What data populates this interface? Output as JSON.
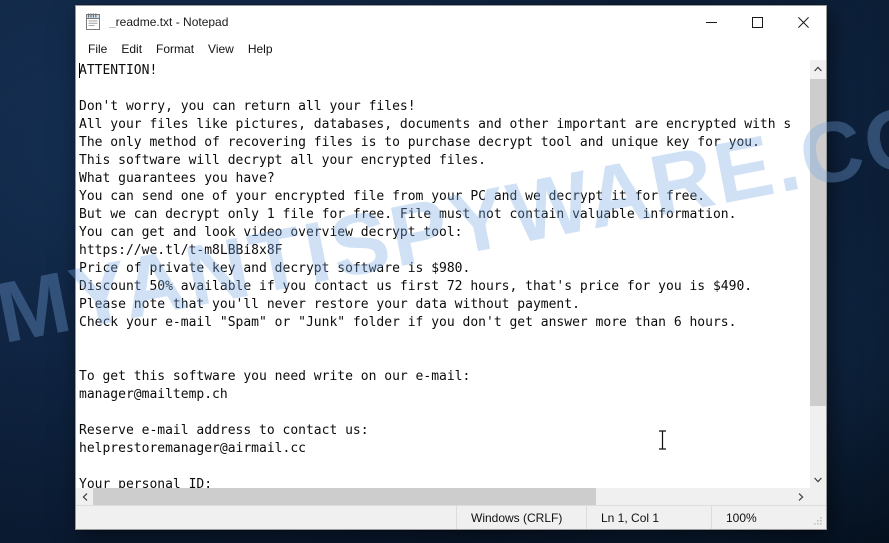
{
  "desktop": {
    "background_color": "#0d2343",
    "watermark_text": "MYANTISPYWARE.COM",
    "watermark_color": "#78a8e2"
  },
  "window": {
    "icon": "notepad-icon",
    "title": "_readme.txt - Notepad",
    "controls": {
      "minimize": "minimize-icon",
      "maximize": "maximize-icon",
      "close": "close-icon"
    }
  },
  "menubar": {
    "items": [
      {
        "label": "File"
      },
      {
        "label": "Edit"
      },
      {
        "label": "Format"
      },
      {
        "label": "View"
      },
      {
        "label": "Help"
      }
    ]
  },
  "editor": {
    "content": "ATTENTION!\n\nDon't worry, you can return all your files!\nAll your files like pictures, databases, documents and other important are encrypted with s\nThe only method of recovering files is to purchase decrypt tool and unique key for you.\nThis software will decrypt all your encrypted files.\nWhat guarantees you have?\nYou can send one of your encrypted file from your PC and we decrypt it for free.\nBut we can decrypt only 1 file for free. File must not contain valuable information.\nYou can get and look video overview decrypt tool:\nhttps://we.tl/t-m8LBBi8x8F\nPrice of private key and decrypt software is $980.\nDiscount 50% available if you contact us first 72 hours, that's price for you is $490.\nPlease note that you'll never restore your data without payment.\nCheck your e-mail \"Spam\" or \"Junk\" folder if you don't get answer more than 6 hours.\n\n\nTo get this software you need write on our e-mail:\nmanager@mailtemp.ch\n\nReserve e-mail address to contact us:\nhelprestoremanager@airmail.cc\n\nYour personal ID:",
    "details": {
      "heading": "ATTENTION!",
      "video_url": "https://we.tl/t-m8LBBi8x8F",
      "price_full": "$980",
      "price_discount": "$490",
      "discount_percent": "50%",
      "discount_window": "72 hours",
      "reply_window": "6 hours",
      "primary_email": "manager@mailtemp.ch",
      "reserve_email": "helprestoremanager@airmail.cc"
    },
    "cursor": "text-ibeam"
  },
  "scrollbars": {
    "vertical": {
      "up": "chevron-up-icon",
      "down": "chevron-down-icon",
      "thumb_position_percent": 0
    },
    "horizontal": {
      "left": "chevron-left-icon",
      "right": "chevron-right-icon",
      "thumb_position_percent": 0
    }
  },
  "statusbar": {
    "encoding": "Windows (CRLF)",
    "position": "Ln 1, Col 1",
    "zoom": "100%"
  }
}
